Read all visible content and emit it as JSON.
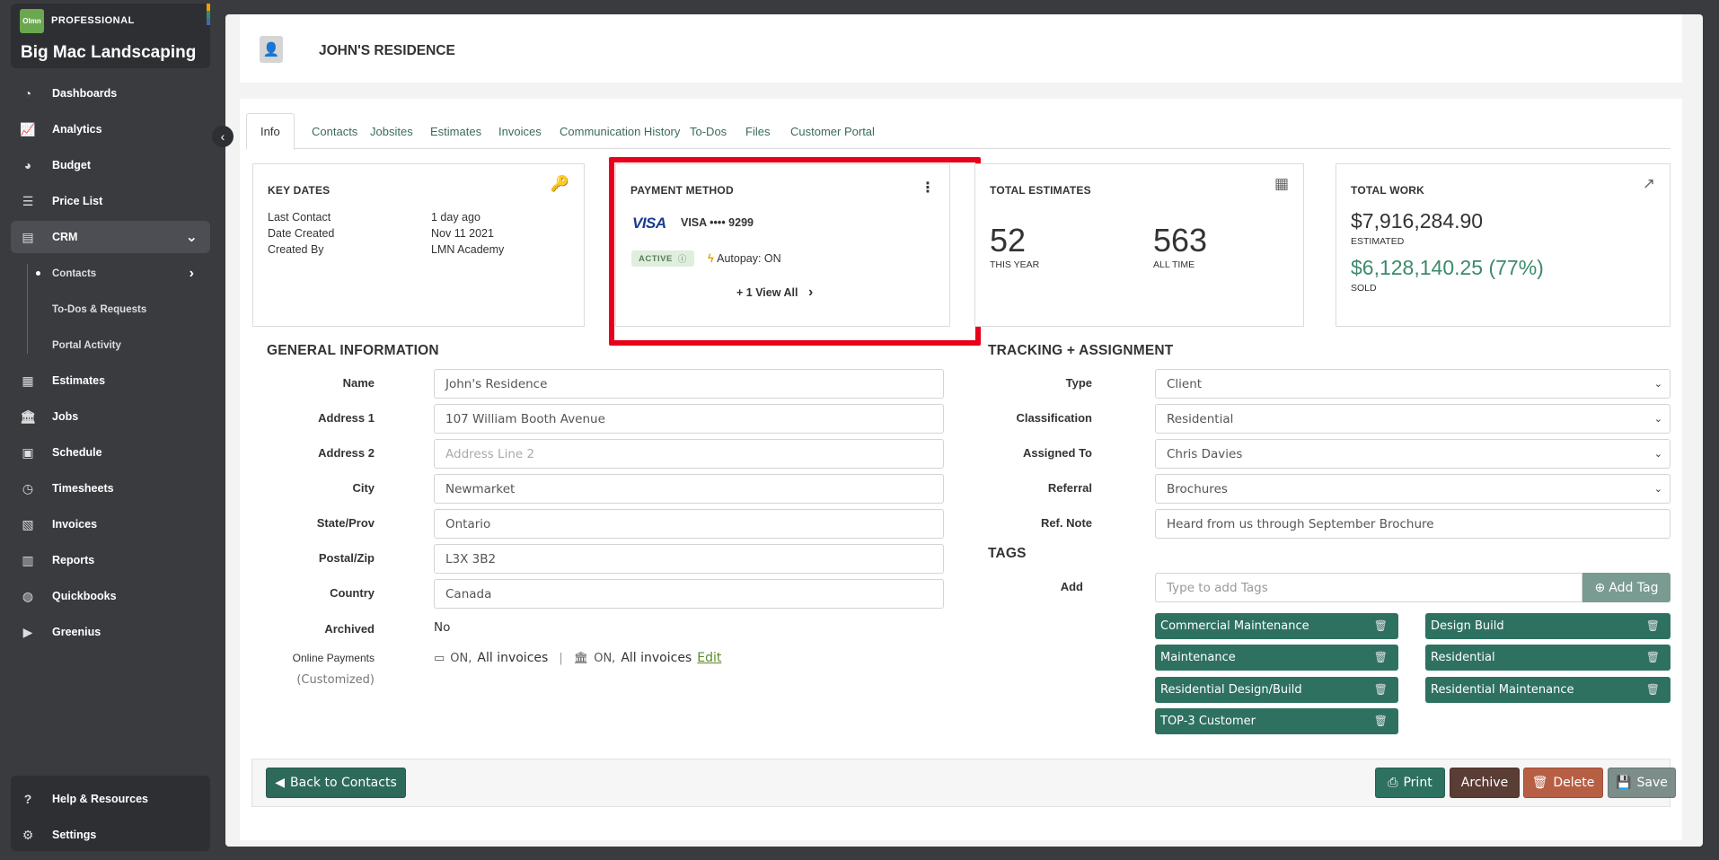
{
  "brand": {
    "logo_text": "Olmn",
    "tier": "PROFESSIONAL",
    "company": "Big Mac Landscaping",
    "bar_colors": [
      "#e8a100",
      "#3d8a6b",
      "#3a6ea5"
    ]
  },
  "sidebar": {
    "items": [
      {
        "label": "Dashboards",
        "icon": "dashboard-icon"
      },
      {
        "label": "Analytics",
        "icon": "line-chart-icon"
      },
      {
        "label": "Budget",
        "icon": "pie-chart-icon"
      },
      {
        "label": "Price List",
        "icon": "list-icon"
      },
      {
        "label": "CRM",
        "icon": "crm-icon"
      },
      {
        "label": "Estimates",
        "icon": "calculator-icon"
      },
      {
        "label": "Jobs",
        "icon": "building-icon"
      },
      {
        "label": "Schedule",
        "icon": "calendar-icon"
      },
      {
        "label": "Timesheets",
        "icon": "clock-icon"
      },
      {
        "label": "Invoices",
        "icon": "invoice-icon"
      },
      {
        "label": "Reports",
        "icon": "report-icon"
      },
      {
        "label": "Quickbooks",
        "icon": "quickbooks-icon"
      },
      {
        "label": "Greenius",
        "icon": "play-icon"
      }
    ],
    "crm_sub": [
      {
        "label": "Contacts"
      },
      {
        "label": "To-Dos & Requests"
      },
      {
        "label": "Portal Activity"
      }
    ],
    "bottom": [
      {
        "label": "Help & Resources",
        "icon": "help-icon"
      },
      {
        "label": "Settings",
        "icon": "gear-icon"
      }
    ]
  },
  "header": {
    "title": "JOHN'S RESIDENCE",
    "icon": "contact-book-icon"
  },
  "tabs": [
    "Info",
    "Contacts",
    "Jobsites",
    "Estimates",
    "Invoices",
    "Communication History",
    "To-Dos",
    "Files",
    "Customer Portal"
  ],
  "key_dates": {
    "title": "KEY DATES",
    "rows": [
      {
        "label": "Last Contact",
        "value": "1 day ago"
      },
      {
        "label": "Date Created",
        "value": "Nov 11 2021"
      },
      {
        "label": "Created By",
        "value": "LMN Academy"
      }
    ]
  },
  "payment": {
    "title": "PAYMENT METHOD",
    "brand": "VISA",
    "card": "VISA •••• 9299",
    "status": "ACTIVE",
    "autopay": "Autopay: ON",
    "view_all": "+ 1 View All"
  },
  "estimates": {
    "title": "TOTAL ESTIMATES",
    "this_year": "52",
    "this_year_label": "THIS YEAR",
    "all_time": "563",
    "all_time_label": "ALL TIME"
  },
  "work": {
    "title": "TOTAL WORK",
    "estimated": "$7,916,284.90",
    "estimated_label": "ESTIMATED",
    "sold": "$6,128,140.25 (77%)",
    "sold_label": "SOLD"
  },
  "general": {
    "title": "GENERAL INFORMATION",
    "fields": [
      {
        "label": "Name",
        "value": "John's Residence",
        "placeholder": ""
      },
      {
        "label": "Address 1",
        "value": "107 William Booth Avenue",
        "placeholder": ""
      },
      {
        "label": "Address 2",
        "value": "",
        "placeholder": "Address Line 2"
      },
      {
        "label": "City",
        "value": "Newmarket",
        "placeholder": ""
      },
      {
        "label": "State/Prov",
        "value": "Ontario",
        "placeholder": ""
      },
      {
        "label": "Postal/Zip",
        "value": "L3X 3B2",
        "placeholder": ""
      },
      {
        "label": "Country",
        "value": "Canada",
        "placeholder": ""
      }
    ],
    "archived_label": "Archived",
    "archived_value": "No",
    "online_label": "Online Payments",
    "online_sub": "(Customized)",
    "card_on": "ON,",
    "card_scope": "All invoices",
    "bank_on": "ON,",
    "bank_scope": "All invoices",
    "edit": "Edit"
  },
  "tracking": {
    "title": "TRACKING + ASSIGNMENT",
    "fields": [
      {
        "label": "Type",
        "value": "Client"
      },
      {
        "label": "Classification",
        "value": "Residential"
      },
      {
        "label": "Assigned To",
        "value": "Chris Davies"
      },
      {
        "label": "Referral",
        "value": "Brochures"
      }
    ],
    "ref_label": "Ref. Note",
    "ref_value": "Heard from us through September Brochure"
  },
  "tags": {
    "title": "TAGS",
    "add_label": "Add",
    "placeholder": "Type to add Tags",
    "add_button": "Add Tag",
    "items": [
      "Commercial Maintenance",
      "Design Build",
      "Maintenance",
      "Residential",
      "Residential Design/Build",
      "Residential Maintenance",
      "TOP-3 Customer"
    ]
  },
  "footer": {
    "back": "Back to Contacts",
    "print": "Print",
    "archive": "Archive",
    "delete": "Delete",
    "save": "Save"
  }
}
